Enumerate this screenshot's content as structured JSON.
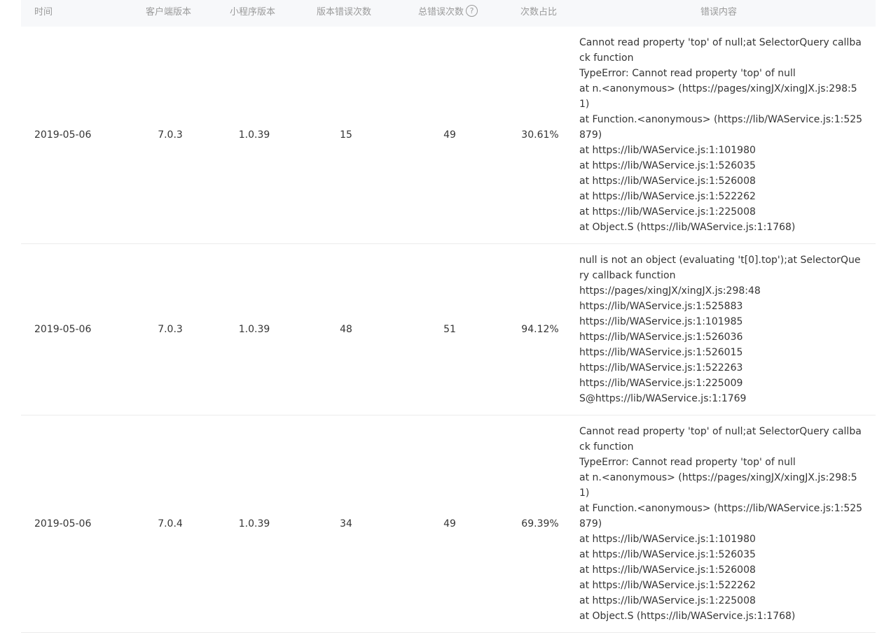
{
  "headers": {
    "time": "时间",
    "client_version": "客户端版本",
    "app_version": "小程序版本",
    "version_errors": "版本错误次数",
    "total_errors": "总错误次数",
    "total_errors_help": "?",
    "ratio": "次数占比",
    "content": "错误内容"
  },
  "rows": [
    {
      "date": "2019-05-06",
      "client": "7.0.3",
      "app": "1.0.39",
      "version_errors": "15",
      "total_errors": "49",
      "ratio": "30.61%",
      "lines": [
        "Cannot read property 'top' of null;at SelectorQuery callback function",
        "TypeError: Cannot read property 'top' of null",
        "at n.<anonymous> (https://pages/xingJX/xingJX.js:298:51)",
        "at Function.<anonymous> (https://lib/WAService.js:1:525879)",
        "at https://lib/WAService.js:1:101980",
        "at https://lib/WAService.js:1:526035",
        "at https://lib/WAService.js:1:526008",
        "at https://lib/WAService.js:1:522262",
        "at https://lib/WAService.js:1:225008",
        "at Object.S (https://lib/WAService.js:1:1768)"
      ]
    },
    {
      "date": "2019-05-06",
      "client": "7.0.3",
      "app": "1.0.39",
      "version_errors": "48",
      "total_errors": "51",
      "ratio": "94.12%",
      "lines": [
        "null is not an object (evaluating 't[0].top');at SelectorQuery callback function",
        "https://pages/xingJX/xingJX.js:298:48",
        "https://lib/WAService.js:1:525883",
        "https://lib/WAService.js:1:101985",
        "https://lib/WAService.js:1:526036",
        "https://lib/WAService.js:1:526015",
        "https://lib/WAService.js:1:522263",
        "https://lib/WAService.js:1:225009",
        "S@https://lib/WAService.js:1:1769"
      ]
    },
    {
      "date": "2019-05-06",
      "client": "7.0.4",
      "app": "1.0.39",
      "version_errors": "34",
      "total_errors": "49",
      "ratio": "69.39%",
      "lines": [
        "Cannot read property 'top' of null;at SelectorQuery callback function",
        "TypeError: Cannot read property 'top' of null",
        "at n.<anonymous> (https://pages/xingJX/xingJX.js:298:51)",
        "at Function.<anonymous> (https://lib/WAService.js:1:525879)",
        "at https://lib/WAService.js:1:101980",
        "at https://lib/WAService.js:1:526035",
        "at https://lib/WAService.js:1:526008",
        "at https://lib/WAService.js:1:522262",
        "at https://lib/WAService.js:1:225008",
        "at Object.S (https://lib/WAService.js:1:1768)"
      ]
    }
  ]
}
